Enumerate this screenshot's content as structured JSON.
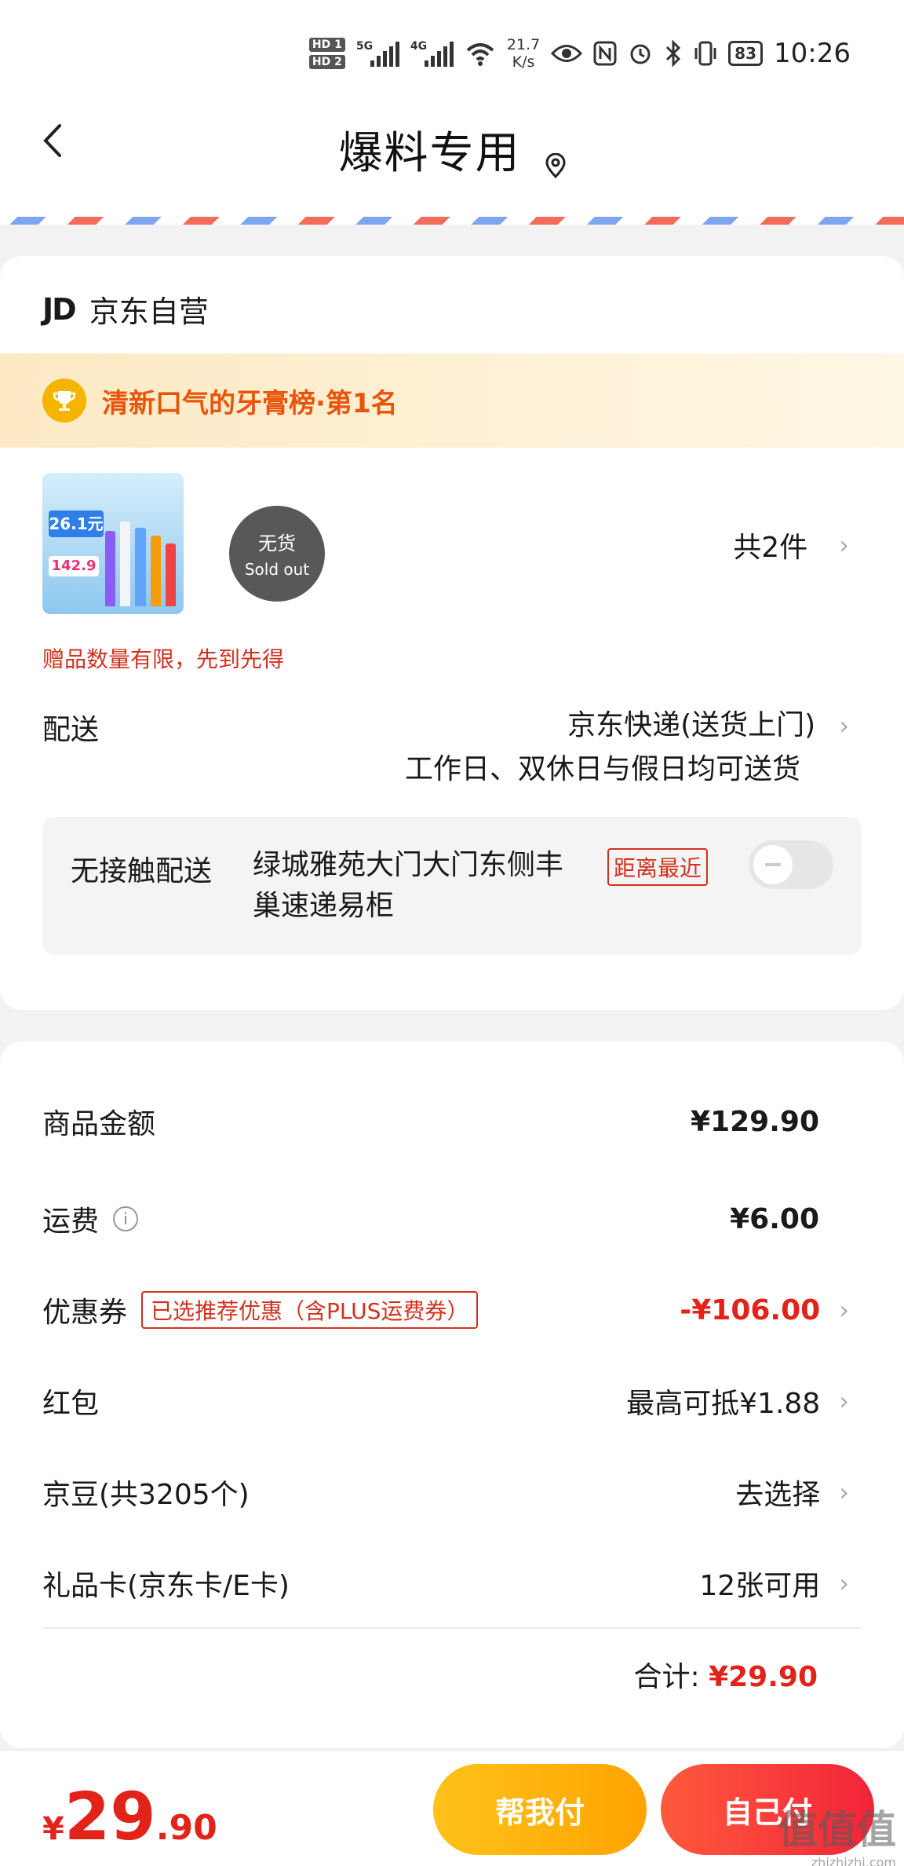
{
  "status_bar": {
    "hd1": "HD 1",
    "hd2": "HD 2",
    "sig1_label": "5G",
    "sig2_label": "4G",
    "speed_value": "21.7",
    "speed_unit": "K/s",
    "battery": "83",
    "time": "10:26"
  },
  "header": {
    "back_icon": "chevron-left-icon",
    "title": "爆料专用",
    "location_icon": "location-pin-icon"
  },
  "shop": {
    "logo": "JD",
    "name": "京东自营"
  },
  "rank_banner": {
    "icon": "trophy-icon",
    "text": "清新口气的牙膏榜·第1名"
  },
  "products": {
    "image_badge_1": "26.1元",
    "image_badge_2": "142.9",
    "sold_out_cn": "无货",
    "sold_out_en": "Sold out",
    "count": "共2件"
  },
  "gift_note": "赠品数量有限，先到先得",
  "shipping": {
    "label": "配送",
    "method": "京东快递(送货上门)",
    "schedule": "工作日、双休日与假日均可送货"
  },
  "contactless": {
    "label": "无接触配送",
    "address": "绿城雅苑大门大门东侧丰巢速递易柜",
    "tag": "距离最近",
    "toggle_on": false
  },
  "fees": {
    "goods_label": "商品金额",
    "goods_value": "¥129.90",
    "freight_label": "运费",
    "freight_value": "¥6.00",
    "coupon_label": "优惠券",
    "coupon_tag": "已选推荐优惠（含PLUS运费券）",
    "coupon_value": "-¥106.00",
    "redpacket_label": "红包",
    "redpacket_value": "最高可抵¥1.88",
    "beans_label": "京豆(共3205个)",
    "beans_value": "去选择",
    "giftcard_label": "礼品卡(京东卡/E卡)",
    "giftcard_value": "12张可用",
    "total_label": "合计:",
    "total_value": "¥29.90"
  },
  "bottom_bar": {
    "currency": "¥",
    "amount_int": "29",
    "amount_dec": ".90",
    "help_pay": "帮我付",
    "self_pay": "自己付",
    "watermark": "值值值",
    "watermark_sub": "zhizhizhi.com"
  },
  "colors": {
    "accent_red": "#e2231a",
    "banner_orange": "#e8540c",
    "help_btn": "#ffa300",
    "self_btn": "#f2233a"
  }
}
